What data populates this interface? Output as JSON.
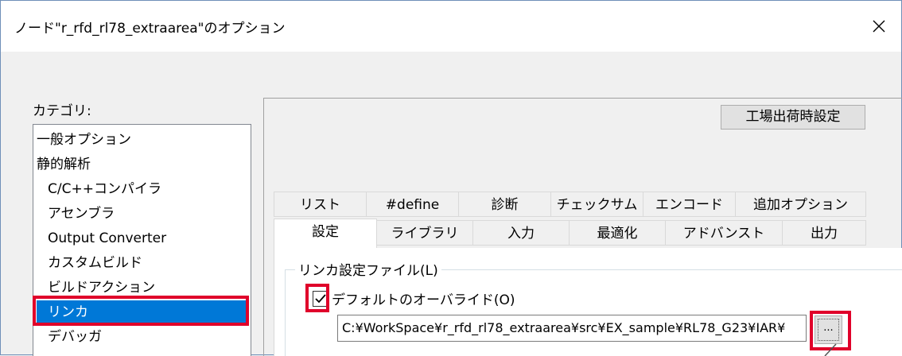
{
  "window": {
    "title": "ノード\"r_rfd_rl78_extraarea\"のオプション"
  },
  "category": {
    "label": "カテゴリ:",
    "items": [
      {
        "label": "一般オプション",
        "selected": false
      },
      {
        "label": "静的解析",
        "selected": false
      },
      {
        "label": "C/C++コンパイラ",
        "selected": false
      },
      {
        "label": "アセンブラ",
        "selected": false
      },
      {
        "label": "Output Converter",
        "selected": false
      },
      {
        "label": "カスタムビルド",
        "selected": false
      },
      {
        "label": "ビルドアクション",
        "selected": false
      },
      {
        "label": "リンカ",
        "selected": true
      },
      {
        "label": "デバッガ",
        "selected": false
      }
    ],
    "selected_color": "#0078d7"
  },
  "factory_button": {
    "label": "工場出荷時設定"
  },
  "tabs": {
    "row1": [
      "リスト",
      "#define",
      "診断",
      "チェックサム",
      "エンコード",
      "追加オプション"
    ],
    "row2": [
      "設定",
      "ライブラリ",
      "入力",
      "最適化",
      "アドバンスト",
      "出力"
    ],
    "active": "設定"
  },
  "linker_settings": {
    "group_label": "リンカ設定ファイル(L)",
    "override_checkbox": {
      "label": "デフォルトのオーバライド(O)",
      "checked": true
    },
    "path_value": "C:¥WorkSpace¥r_rfd_rl78_extraarea¥src¥EX_sample¥RL78_G23¥IAR¥",
    "browse_label": "..."
  },
  "highlight_color": "#e0002a"
}
